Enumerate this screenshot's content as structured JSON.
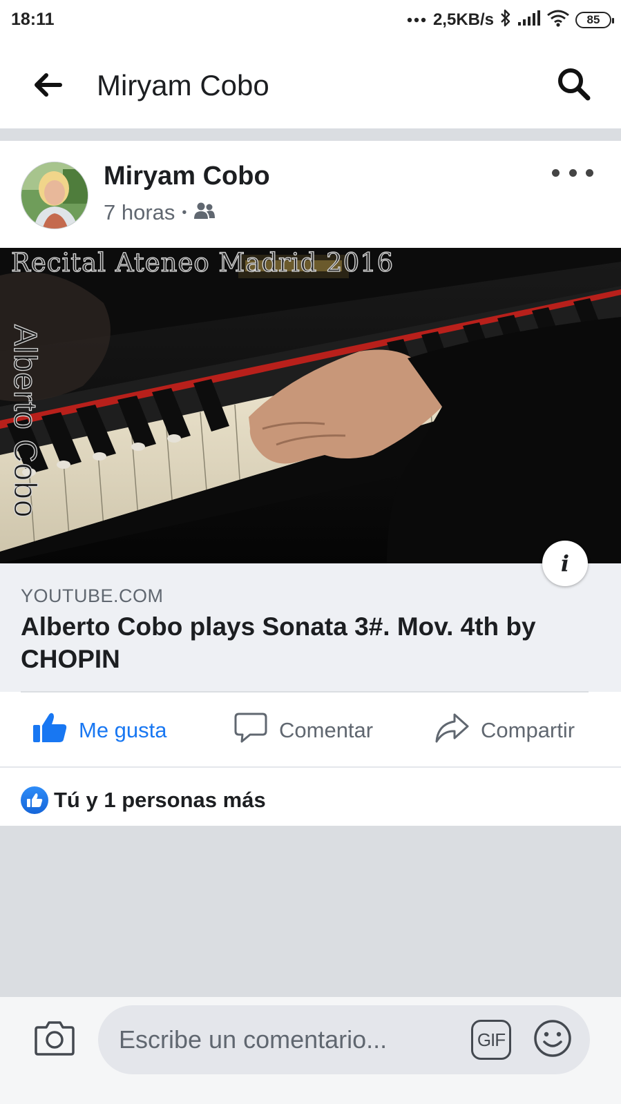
{
  "status_bar": {
    "time": "18:11",
    "network_speed": "2,5KB/s",
    "battery": "85"
  },
  "app_bar": {
    "title": "Miryam Cobo",
    "back_icon": "arrow-left-icon",
    "search_icon": "search-icon"
  },
  "post": {
    "author": "Miryam Cobo",
    "time": "7 horas",
    "separator": "•",
    "audience_icon": "friends-icon",
    "more_icon": "more-horizontal-icon",
    "video": {
      "watermark_top": "Recital Ateneo Madrid 2016",
      "watermark_side": "Alberto Cobo"
    },
    "link": {
      "source": "YOUTUBE.COM",
      "title": "Alberto Cobo plays Sonata 3#. Mov. 4th by CHOPIN"
    }
  },
  "actions": {
    "like": "Me gusta",
    "comment": "Comentar",
    "share": "Compartir"
  },
  "reactions": {
    "text": "Tú y 1 personas más"
  },
  "composer": {
    "placeholder": "Escribe un comentario...",
    "gif_label": "GIF",
    "camera_icon": "camera-icon",
    "emoji_icon": "emoji-icon"
  },
  "colors": {
    "accent": "#1877f2",
    "divider": "#dadde1",
    "link_background": "#eef0f4",
    "secondary_text": "#606770"
  }
}
